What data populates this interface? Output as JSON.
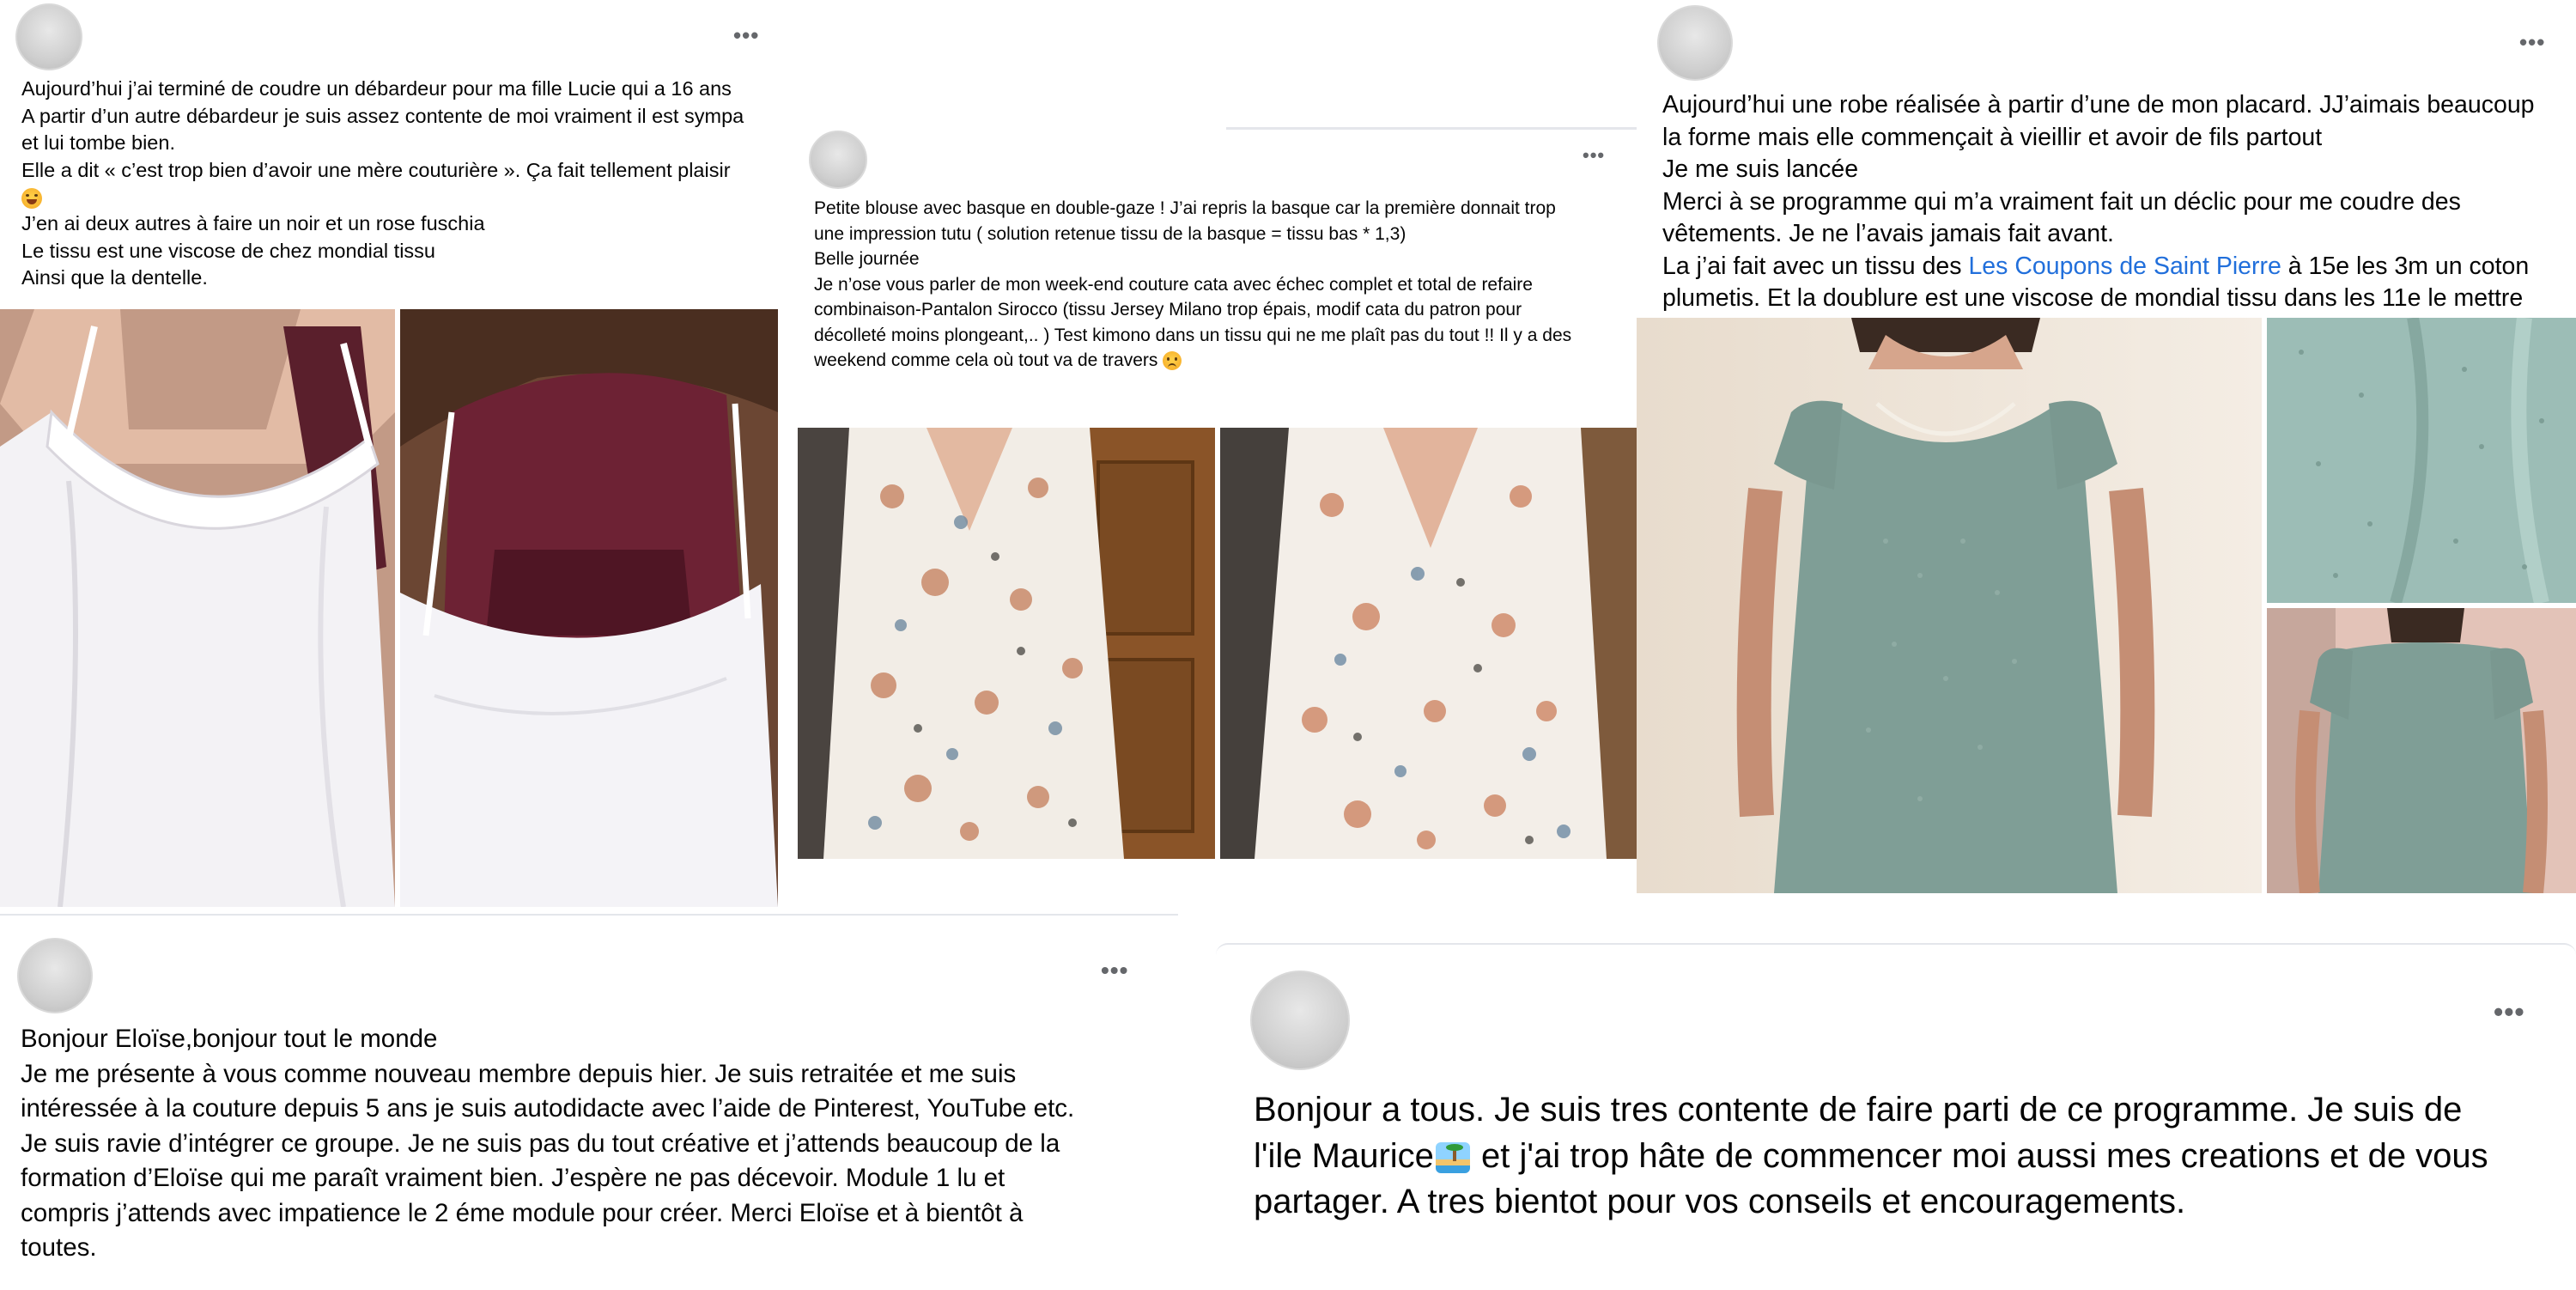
{
  "posts": [
    {
      "author_avatar": "avatar",
      "more_label": "•••",
      "lines": [
        "Aujourd’hui j’ai terminé de coudre un débardeur pour ma  fille Lucie qui a 16 ans",
        "A partir d’un autre débardeur je suis assez contente de moi vraiment il est sympa",
        "et lui tombe bien.",
        "Elle a dit « c’est trop bien d’avoir une mère couturière ». Ça fait tellement plaisir",
        "J’en ai deux autres à faire un noir et un rose fuschia",
        "Le tissu est une viscose de chez mondial tissu",
        "Ainsi que la dentelle."
      ],
      "emoji": "smiling-face-emoji",
      "photos": [
        "white-camisole-front-photo",
        "white-camisole-back-photo"
      ]
    },
    {
      "author_avatar": "avatar",
      "more_label": "•••",
      "lines": [
        "Petite blouse avec basque en double-gaze ! J’ai repris la basque car la première donnait trop",
        "une impression tutu ( solution retenue tissu de la basque = tissu bas * 1,3)",
        "Belle journée",
        "Je n’ose vous parler de mon week-end couture cata avec échec complet et total de refaire",
        "combinaison-Pantalon Sirocco (tissu Jersey Milano trop épais, modif cata du patron pour",
        "décolleté moins plongeant,.. ) Test kimono dans un tissu qui ne me plaît pas du tout !! Il y a des",
        "weekend comme cela où tout va de travers"
      ],
      "emoji": "frowning-face-emoji",
      "photos": [
        "floral-blouse-photo-1",
        "floral-blouse-photo-2"
      ]
    },
    {
      "author_avatar": "avatar",
      "more_label": "•••",
      "lines": [
        "Aujourd’hui une robe réalisée à partir d’une de mon placard. JJ’aimais beaucoup",
        "la forme mais elle commençait à vieillir et avoir de fils partout",
        "Je me suis lancée",
        "Merci à se programme qui m’a vraiment fait un déclic pour me coudre des",
        "vêtements. Je ne l’avais jamais fait avant.",
        "plumetis. Et la doublure est une viscose de mondial tissu dans les 11e le mettre"
      ],
      "link_line_before": "La j’ai fait avec un tissu des ",
      "link_text": "Les Coupons de Saint Pierre",
      "link_line_after": " à 15e les 3m un coton",
      "photos": [
        "green-dress-front-photo",
        "fabric-detail-photo",
        "green-dress-back-photo"
      ]
    },
    {
      "author_avatar": "avatar",
      "more_label": "•••",
      "lines": [
        "Bonjour Eloïse,bonjour tout le monde",
        "Je me présente à vous comme nouveau membre depuis hier. Je suis retraitée et me suis",
        "intéressée à la couture depuis 5 ans je suis autodidacte avec l’aide de Pinterest, YouTube etc.",
        "Je suis ravie d’intégrer ce groupe. Je ne suis pas du tout créative et j’attends beaucoup de la",
        "formation d’Eloïse qui me paraît vraiment bien. J’espère ne pas décevoir. Module 1 lu et",
        "compris j’attends avec impatience le 2 éme module pour créer. Merci Eloïse et à bientôt à",
        "toutes."
      ]
    },
    {
      "author_avatar": "avatar",
      "more_label": "•••",
      "lines": [
        "Bonjour a tous. Je suis tres contente de faire parti de ce programme. Je suis de",
        "l'ile Maurice",
        " et j'ai trop hâte de commencer moi aussi mes creations et de vous",
        "partager. A tres bientot pour vos conseils et encouragements."
      ],
      "emoji": "island-emoji"
    }
  ],
  "colors": {
    "text": "#050505",
    "link": "#216fdb",
    "muted": "#65676b"
  }
}
